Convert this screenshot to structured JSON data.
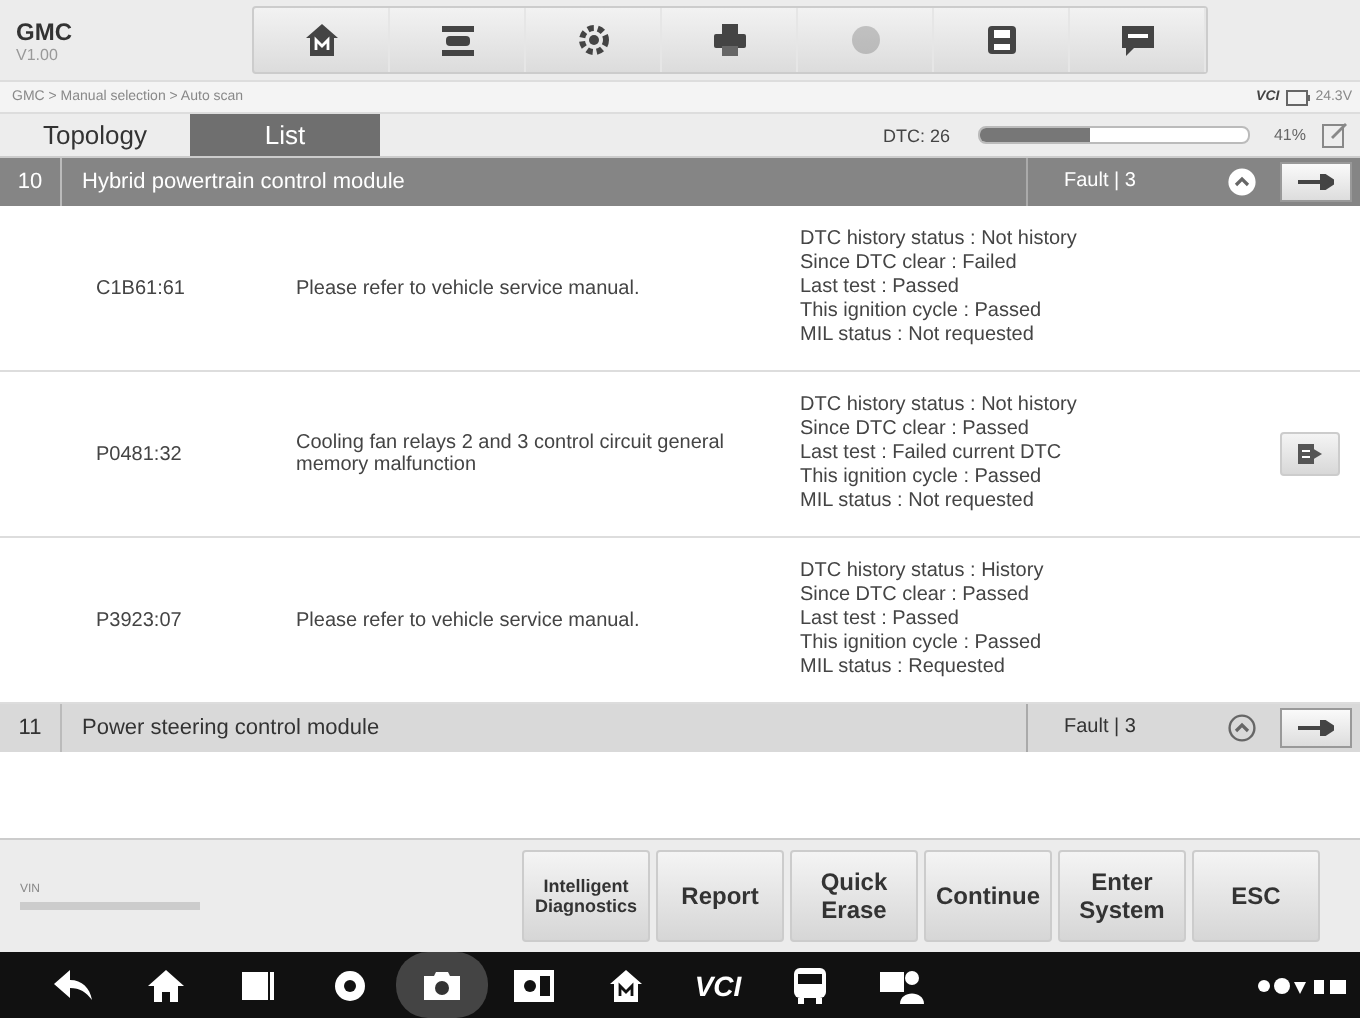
{
  "header": {
    "title": "GMC",
    "version": "V1.00"
  },
  "toolbar": [
    {
      "disabled": false
    },
    {
      "disabled": false
    },
    {
      "disabled": false
    },
    {
      "disabled": false
    },
    {
      "disabled": true
    },
    {
      "disabled": false
    },
    {
      "disabled": false
    }
  ],
  "breadcrumb": "GMC > Manual selection > Auto scan",
  "vci": {
    "label": "VCI",
    "voltage": "24.3V"
  },
  "tabs": [
    {
      "label": "Topology",
      "selected": false
    },
    {
      "label": "List",
      "selected": true
    }
  ],
  "dtc_count": "DTC: 26",
  "progress": {
    "level": 0.41,
    "reading": "41%"
  },
  "modules": [
    {
      "number": "10",
      "name": "Hybrid powertrain control module",
      "fault": "Fault | 3",
      "expanded": true,
      "selected": true,
      "codes": [
        {
          "code": "C1B61:61",
          "description": "Please refer to vehicle service manual.",
          "status": [
            "DTC history status : Not history",
            "Since DTC clear : Failed",
            "Last test : Passed",
            "This ignition cycle : Passed",
            "MIL status : Not requested"
          ],
          "has_action": false
        },
        {
          "code": "P0481:32",
          "description": "Cooling fan relays 2 and 3 control circuit general memory malfunction",
          "status": [
            "DTC history status : Not history",
            "Since DTC clear : Passed",
            "Last test : Failed current DTC",
            "This ignition cycle : Passed",
            "MIL status : Not requested"
          ],
          "has_action": true
        },
        {
          "code": "P3923:07",
          "description": "Please refer to vehicle service manual.",
          "status": [
            "DTC history status : History",
            "Since DTC clear : Passed",
            "Last test : Passed",
            "This ignition cycle : Passed",
            "MIL status : Requested"
          ],
          "has_action": false
        }
      ]
    },
    {
      "number": "11",
      "name": "Power steering control module",
      "fault": "Fault | 3",
      "expanded": false,
      "selected": false
    }
  ],
  "vin_label": "VIN",
  "buttons": [
    "Intelligent Diagnostics",
    "Report",
    "Quick Erase",
    "Continue",
    "Enter System",
    "ESC"
  ],
  "navbar": [
    {
      "selected": false
    },
    {
      "selected": false
    },
    {
      "selected": false
    },
    {
      "selected": false
    },
    {
      "selected": true
    },
    {
      "selected": false
    },
    {
      "selected": false
    },
    {
      "selected": false,
      "label": "VCI"
    },
    {
      "selected": false
    },
    {
      "selected": false
    }
  ]
}
